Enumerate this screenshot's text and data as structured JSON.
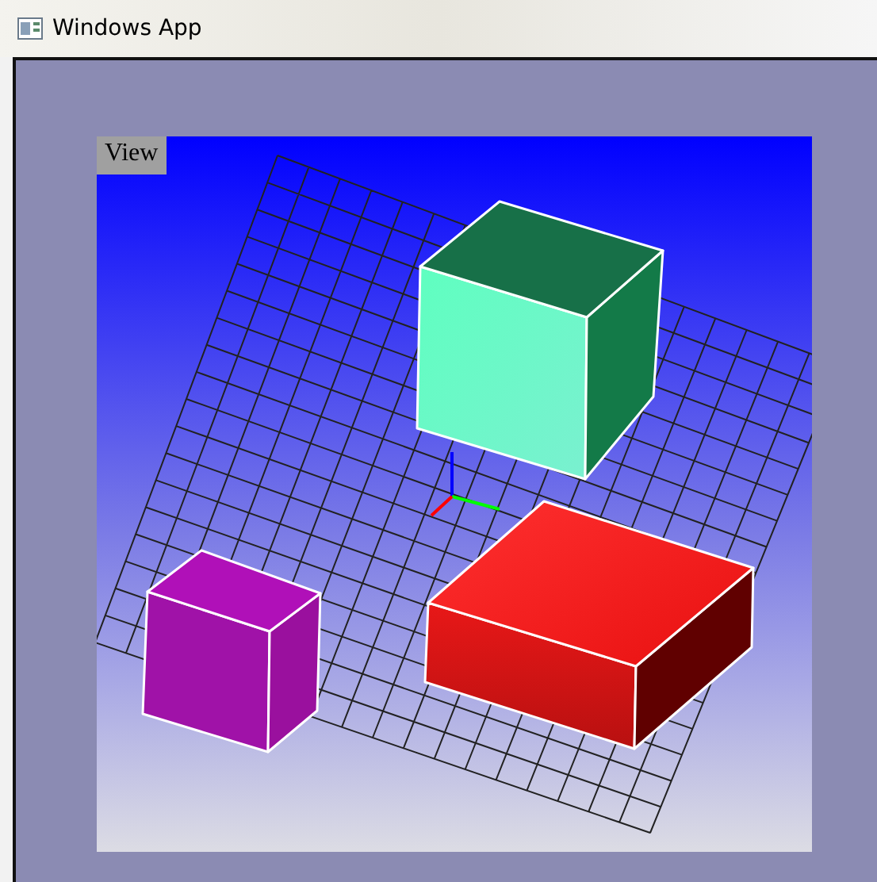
{
  "window": {
    "title": "Windows App"
  },
  "viewport": {
    "label": "View"
  }
}
